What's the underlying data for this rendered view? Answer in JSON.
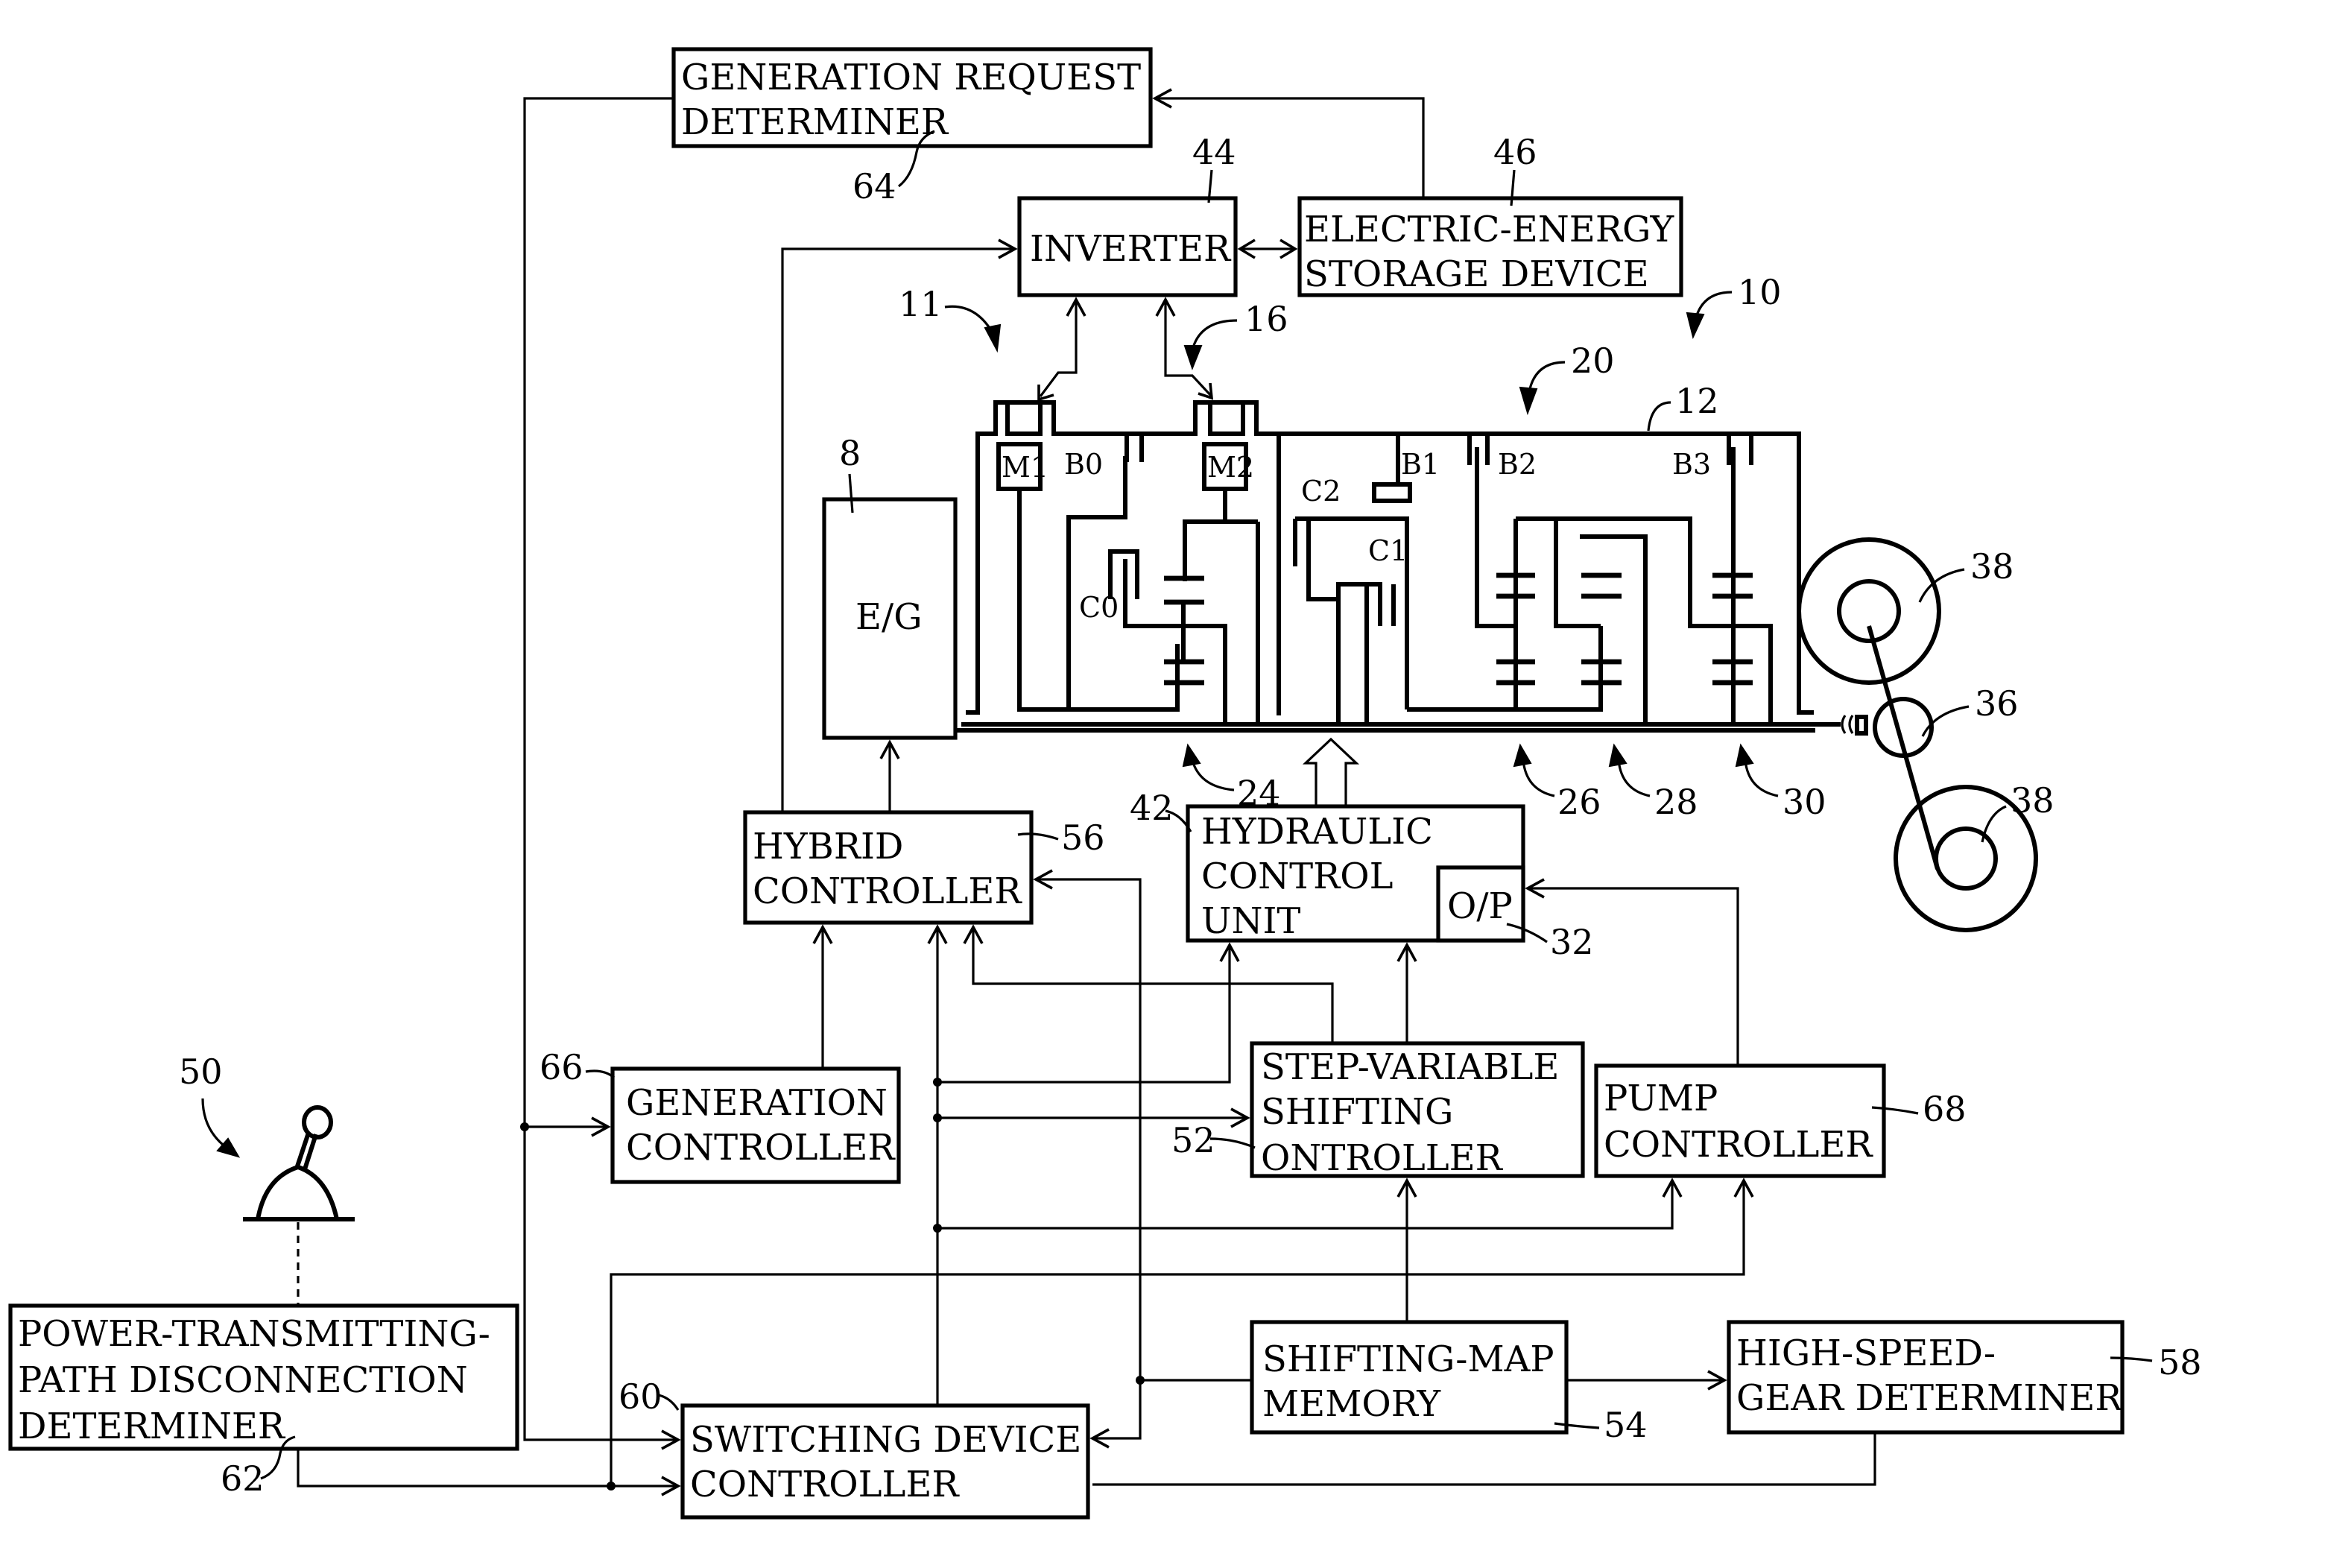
{
  "figure": {
    "blocks": {
      "generation_request_determiner": {
        "lines": [
          "GENERATION REQUEST",
          "DETERMINER"
        ],
        "ref": "64"
      },
      "inverter": {
        "lines": [
          "INVERTER"
        ],
        "ref": "44"
      },
      "storage_device": {
        "lines": [
          "ELECTRIC-ENERGY",
          "STORAGE DEVICE"
        ],
        "ref": "46"
      },
      "engine": {
        "lines": [
          "E/G"
        ],
        "ref": "8"
      },
      "hybrid_controller": {
        "lines": [
          "HYBRID",
          "CONTROLLER"
        ],
        "ref": "56"
      },
      "hydraulic_control_unit": {
        "lines": [
          "HYDRAULIC",
          "CONTROL",
          "UNIT"
        ],
        "ref": "42"
      },
      "oil_pump": {
        "lines": [
          "O/P"
        ],
        "ref": "32"
      },
      "generation_controller": {
        "lines": [
          "GENERATION",
          "CONTROLLER"
        ],
        "ref": "66"
      },
      "step_variable_shifting_controller": {
        "lines": [
          "STEP-VARIABLE",
          "SHIFTING",
          "ONTROLLER"
        ],
        "ref": "52"
      },
      "pump_controller": {
        "lines": [
          "PUMP",
          "CONTROLLER"
        ],
        "ref": "68"
      },
      "power_path_disconnection_determiner": {
        "lines": [
          "POWER-TRANSMITTING-",
          "PATH DISCONNECTION",
          "DETERMINER"
        ],
        "ref": "62"
      },
      "switching_device_controller": {
        "lines": [
          "SWITCHING DEVICE",
          "CONTROLLER"
        ],
        "ref": "60"
      },
      "shifting_map_memory": {
        "lines": [
          "SHIFTING-MAP",
          "MEMORY"
        ],
        "ref": "54"
      },
      "high_speed_gear_determiner": {
        "lines": [
          "HIGH-SPEED-",
          "GEAR DETERMINER"
        ],
        "ref": "58"
      }
    },
    "components": {
      "motor1": "M1",
      "motor2": "M2",
      "brake0": "B0",
      "brake1": "B1",
      "brake2": "B2",
      "brake3": "B3",
      "clutch0": "C0",
      "clutch1": "C1",
      "clutch2": "C2"
    },
    "reference_numerals": {
      "drive_system": "10",
      "control_device": "11",
      "transmission_case": "12",
      "differential_portion": "16",
      "automatic_transmission_portion": "20",
      "planetary_24": "24",
      "planetary_26": "26",
      "planetary_28": "28",
      "planetary_30": "30",
      "differential_gear": "36",
      "wheel_upper": "38",
      "wheel_lower": "38",
      "shift_lever": "50"
    }
  }
}
